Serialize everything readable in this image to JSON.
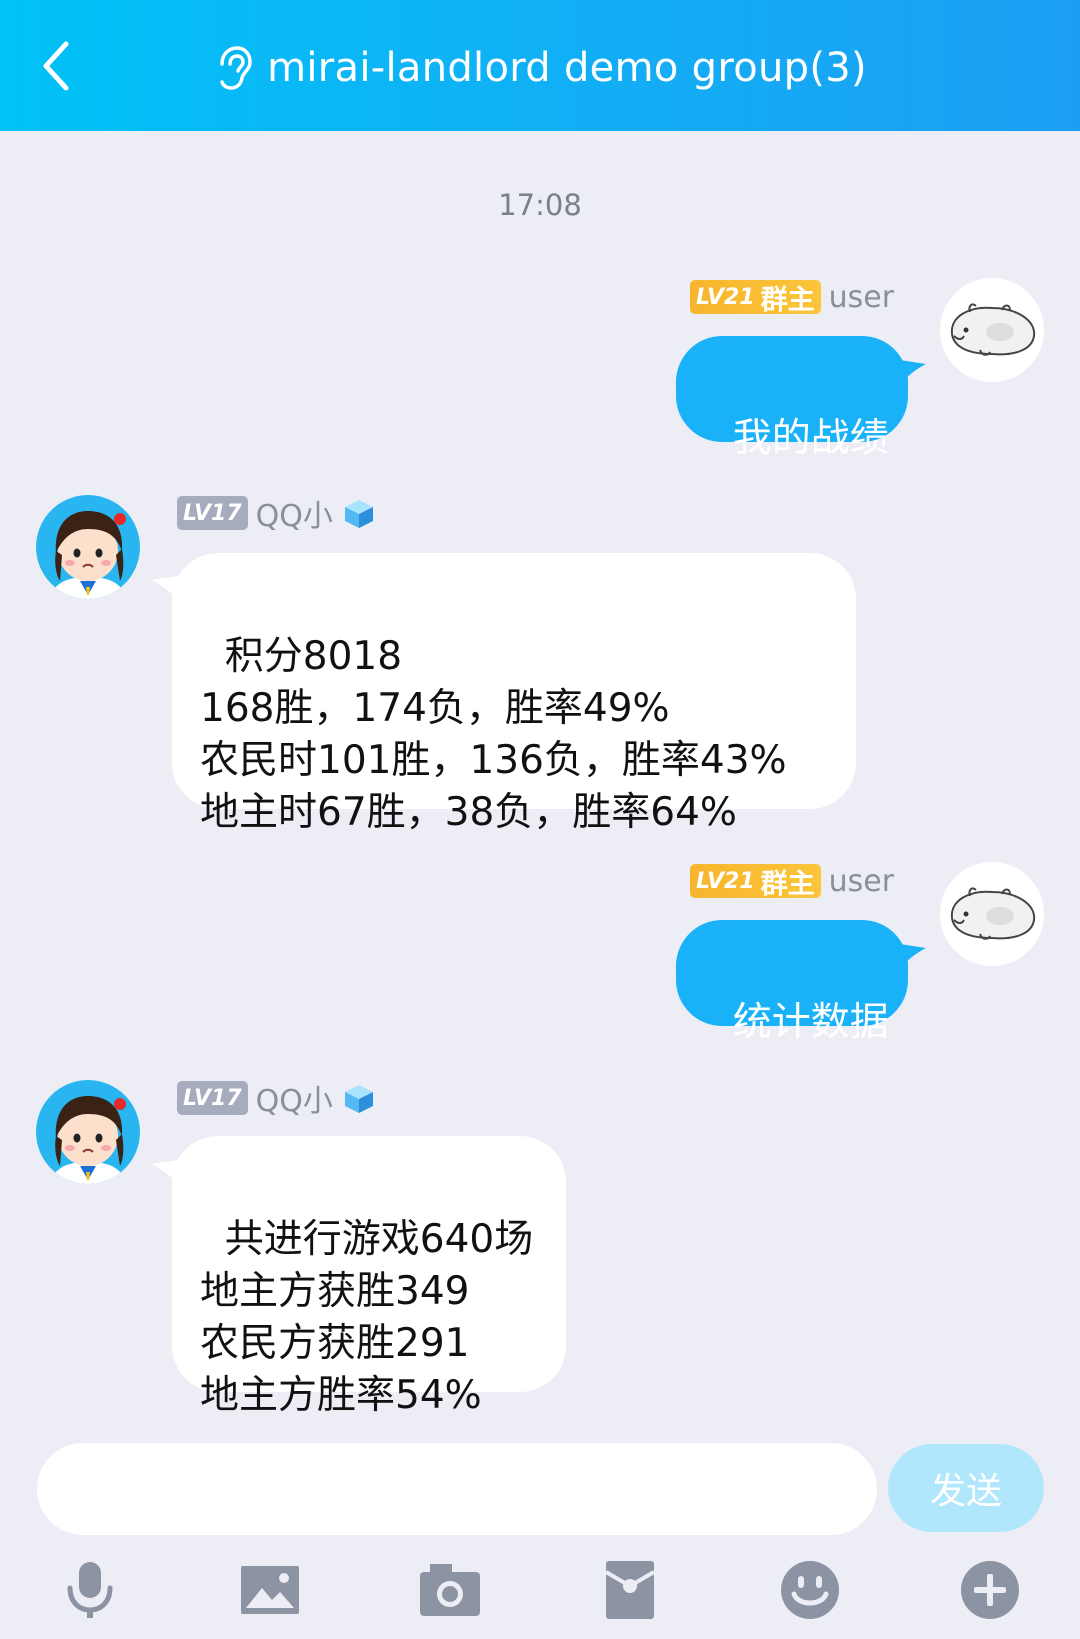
{
  "header": {
    "title": "mirai-landlord demo group(3)",
    "back_icon": "chevron-left-icon",
    "mode_icon": "ear-icon",
    "gradient": [
      "#00c2f6",
      "#1c9ff3"
    ]
  },
  "chat": {
    "timestamp": "17:08",
    "messages": [
      {
        "sender": "user",
        "level": "LV21",
        "role": "群主",
        "text": "我的战绩"
      },
      {
        "sender": "QQ小",
        "level": "LV17",
        "text": "积分8018\n168胜，174负，胜率49%\n农民时101胜，136负，胜率43%\n地主时67胜，38负，胜率64%"
      },
      {
        "sender": "user",
        "level": "LV21",
        "role": "群主",
        "text": "统计数据"
      },
      {
        "sender": "QQ小",
        "level": "LV17",
        "text": "共进行游戏640场\n地主方获胜349\n农民方获胜291\n地主方胜率54%"
      }
    ]
  },
  "composer": {
    "input_value": "",
    "input_placeholder": "",
    "send_label": "发送"
  },
  "toolbar": {
    "icons": [
      "microphone-icon",
      "image-icon",
      "camera-icon",
      "red-packet-icon",
      "emoji-icon",
      "plus-icon"
    ]
  },
  "colors": {
    "background": "#ededf5",
    "user_bubble": "#19b1f8",
    "bot_bubble": "#ffffff",
    "send_button": "#b1e7fc",
    "level_gold": "#f7b52c",
    "level_gray": "#a6abbe",
    "toolbar_icon": "#8c93a3"
  }
}
